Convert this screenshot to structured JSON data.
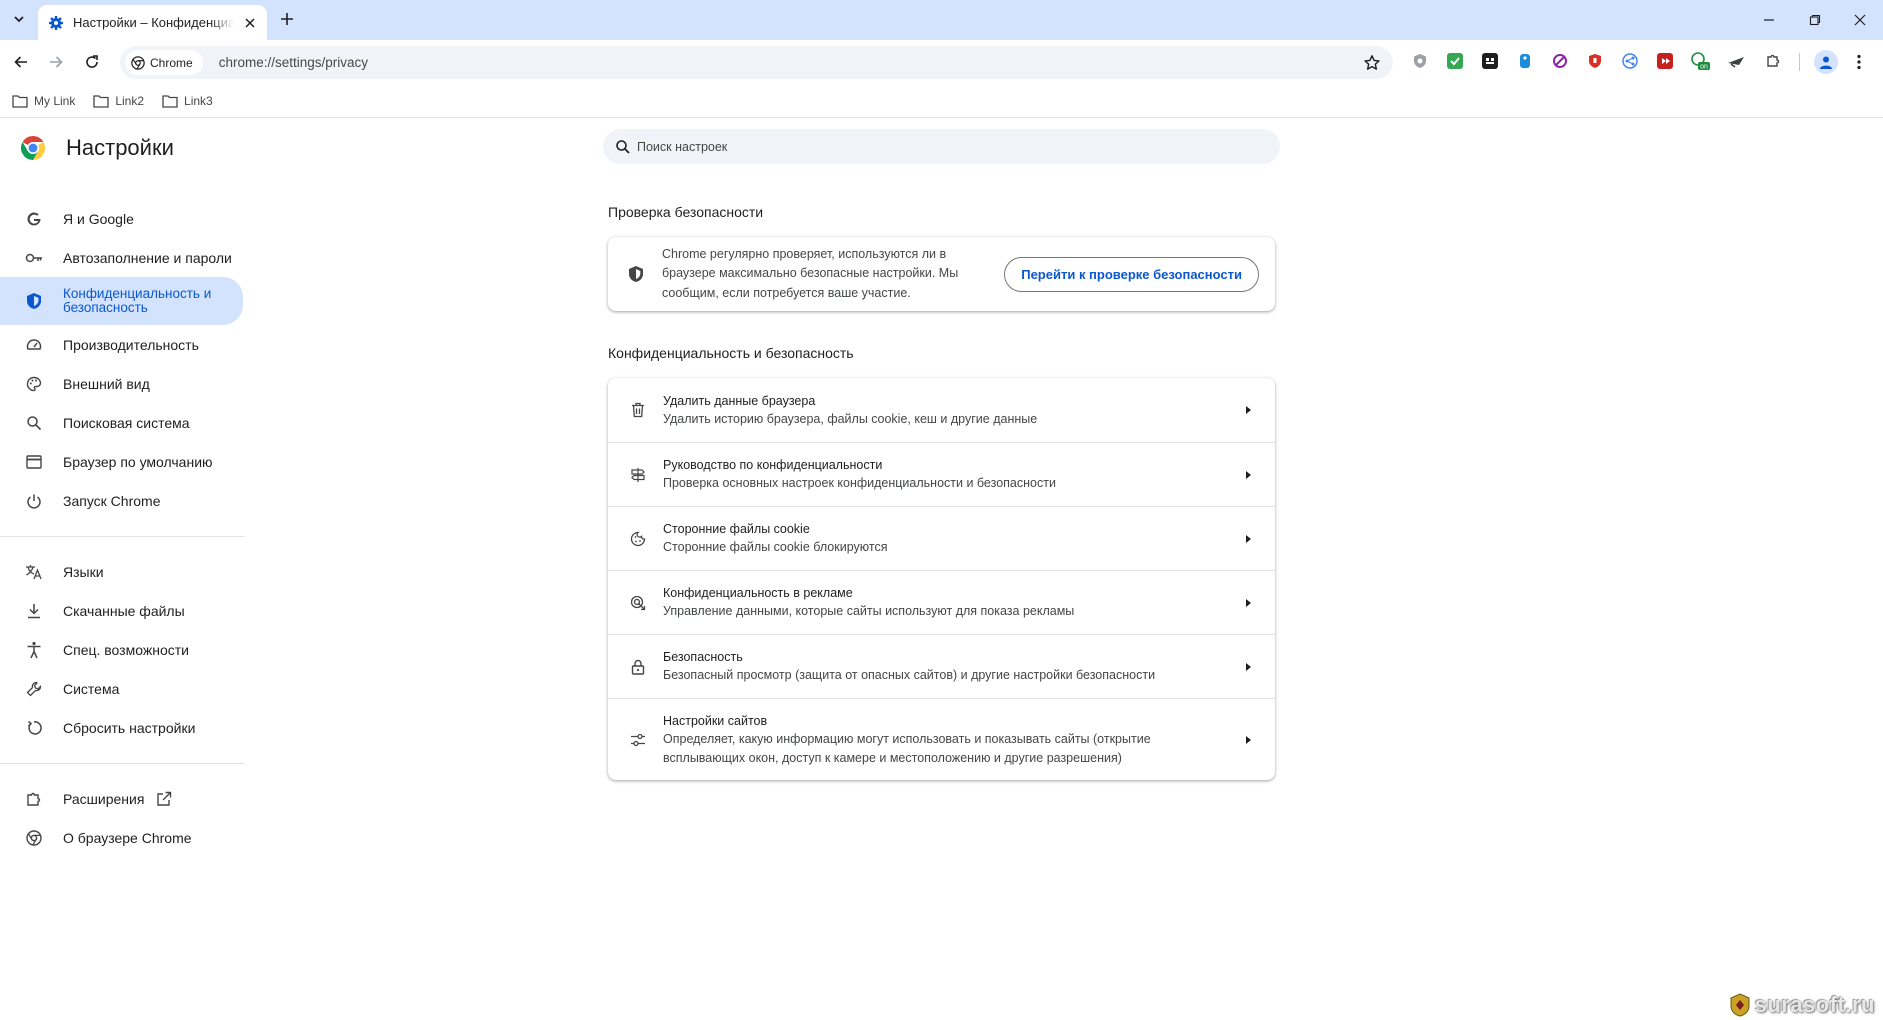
{
  "browser": {
    "tab": {
      "title": "Настройки – Конфиденциальность и безопасность"
    },
    "omnibox": {
      "chip": "Chrome",
      "url": "chrome://settings/privacy"
    },
    "extensions": [
      {
        "name": "shield-ext",
        "color": "#9aa0a6"
      },
      {
        "name": "check-ext",
        "color": "#34a853"
      },
      {
        "name": "game-ext",
        "color": "#1f1f1f"
      },
      {
        "name": "tag-ext",
        "color": "#1a8cd8"
      },
      {
        "name": "block-ext",
        "color": "#8e24aa"
      },
      {
        "name": "ublock-ext",
        "color": "#d93025"
      },
      {
        "name": "share-ext",
        "color": "#4285f4"
      },
      {
        "name": "play-ext",
        "color": "#c5221f"
      },
      {
        "name": "on-ext",
        "color": "#1e8e3e",
        "badge": "on"
      },
      {
        "name": "plane-ext",
        "color": "#3c4043"
      },
      {
        "name": "puzzle-ext",
        "color": "#444746"
      }
    ]
  },
  "bookmarks": [
    {
      "label": "My Link"
    },
    {
      "label": "Link2"
    },
    {
      "label": "Link3"
    }
  ],
  "settings": {
    "title": "Настройки",
    "search_placeholder": "Поиск настроек",
    "nav": [
      {
        "label": "Я и Google",
        "icon": "google-icon"
      },
      {
        "label": "Автозаполнение и пароли",
        "icon": "key-icon"
      },
      {
        "label": "Конфиденциальность и безопасность",
        "icon": "shield-icon",
        "active": true
      },
      {
        "label": "Производительность",
        "icon": "speedometer-icon"
      },
      {
        "label": "Внешний вид",
        "icon": "palette-icon"
      },
      {
        "label": "Поисковая система",
        "icon": "search-icon"
      },
      {
        "label": "Браузер по умолчанию",
        "icon": "browser-window-icon"
      },
      {
        "label": "Запуск Chrome",
        "icon": "power-icon"
      }
    ],
    "nav2": [
      {
        "label": "Языки",
        "icon": "translate-icon"
      },
      {
        "label": "Скачанные файлы",
        "icon": "download-icon"
      },
      {
        "label": "Спец. возможности",
        "icon": "accessibility-icon"
      },
      {
        "label": "Система",
        "icon": "wrench-icon"
      },
      {
        "label": "Сбросить настройки",
        "icon": "reset-icon"
      }
    ],
    "nav3": [
      {
        "label": "Расширения",
        "icon": "puzzle-icon"
      },
      {
        "label": "О браузере Chrome",
        "icon": "chrome-icon"
      }
    ],
    "safety_check": {
      "heading": "Проверка безопасности",
      "text": "Chrome регулярно проверяет, используются ли в браузере максимально безопасные настройки. Мы сообщим, если потребуется ваше участие.",
      "button": "Перейти к проверке безопасности"
    },
    "privacy": {
      "heading": "Конфиденциальность и безопасность",
      "rows": [
        {
          "title": "Удалить данные браузера",
          "subtitle": "Удалить историю браузера, файлы cookie, кеш и другие данные",
          "icon": "trash-icon"
        },
        {
          "title": "Руководство по конфиденциальности",
          "subtitle": "Проверка основных настроек конфиденциальности и безопасности",
          "icon": "signpost-icon"
        },
        {
          "title": "Сторонние файлы cookie",
          "subtitle": "Сторонние файлы cookie блокируются",
          "icon": "cookie-icon"
        },
        {
          "title": "Конфиденциальность в рекламе",
          "subtitle": "Управление данными, которые сайты используют для показа рекламы",
          "icon": "ad-privacy-icon"
        },
        {
          "title": "Безопасность",
          "subtitle": "Безопасный просмотр (защита от опасных сайтов) и другие настройки безопасности",
          "icon": "lock-icon"
        },
        {
          "title": "Настройки сайтов",
          "subtitle": "Определяет, какую информацию могут использовать и показывать сайты (открытие всплывающих окон, доступ к камере и местоположению и другие разрешения)",
          "icon": "tune-icon"
        }
      ]
    }
  },
  "watermark": "surasoft.ru",
  "colors": {
    "accent": "#0b57d0",
    "active_bg": "#d3e3fd",
    "tabstrip": "#d3e3fd"
  }
}
